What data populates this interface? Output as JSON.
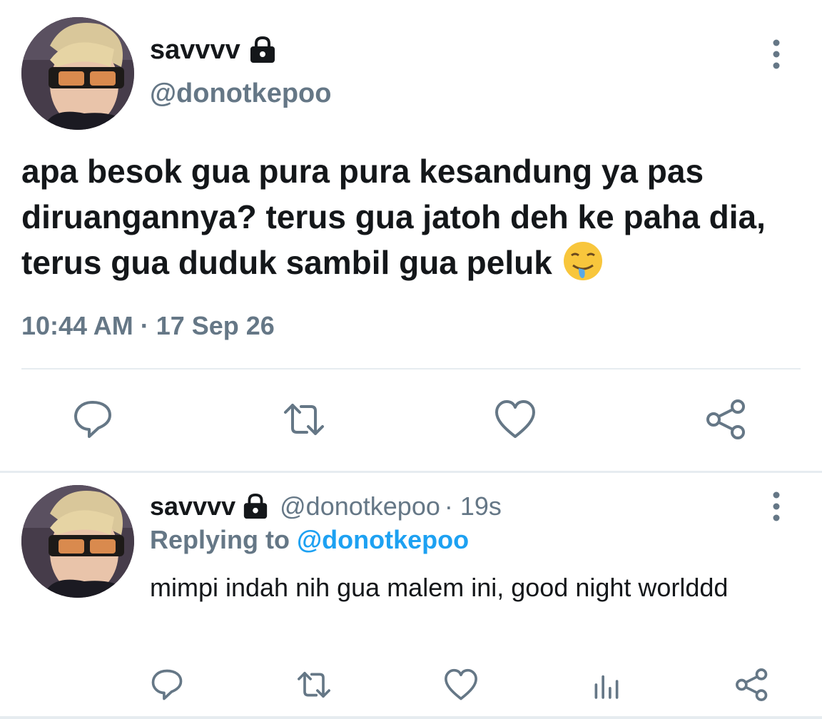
{
  "main_tweet": {
    "display_name": "savvvv",
    "handle": "@donotkepoo",
    "text": "apa besok gua pura pura kesandung ya pas diruangannya? terus gua jatoh deh ke paha dia, terus gua duduk sambil gua peluk",
    "emoji": "drooling-face",
    "timestamp": "10:44 AM · 17 Sep 26",
    "actions": [
      "reply-icon",
      "retweet-icon",
      "like-icon",
      "share-icon"
    ]
  },
  "reply_tweet": {
    "display_name": "savvvv",
    "handle": "@donotkepoo",
    "time": "· 19s",
    "replying_prefix": "Replying to",
    "replying_handle": "@donotkepoo",
    "text": "mimpi indah nih gua malem ini, good night worlddd",
    "actions": [
      "reply-icon",
      "retweet-icon",
      "like-icon",
      "analytics-icon",
      "share-icon"
    ]
  },
  "colors": {
    "text_primary": "#14171a",
    "text_secondary": "#657786",
    "accent": "#1da1f2",
    "divider": "#e6ecf0"
  }
}
